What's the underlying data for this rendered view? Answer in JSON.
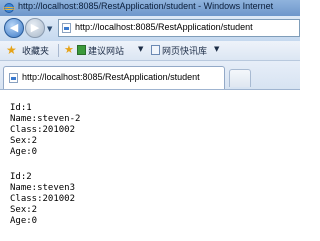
{
  "window": {
    "title": "http://localhost:8085/RestApplication/student - Windows Internet"
  },
  "nav": {
    "back_glyph": "◀",
    "forward_glyph": "▶",
    "dropdown_glyph": "▼",
    "address": "http://localhost:8085/RestApplication/student"
  },
  "favorites_bar": {
    "favorites_label": "收藏夹",
    "suggested_sites_label": "建议网站",
    "web_slice_gallery_label": "网页快讯库",
    "dropdown_glyph": "▼"
  },
  "tab": {
    "title": "http://localhost:8085/RestApplication/student"
  },
  "students": [
    {
      "id": "Id:1",
      "name": "Name:steven-2",
      "class": "Class:201002",
      "sex": "Sex:2",
      "age": "Age:0"
    },
    {
      "id": "Id:2",
      "name": "Name:steven3",
      "class": "Class:201002",
      "sex": "Sex:2",
      "age": "Age:0"
    }
  ],
  "colors": {
    "titlebar": "#7aa3d6",
    "accent_blue": "#3a78c6",
    "star": "#e6a317"
  }
}
